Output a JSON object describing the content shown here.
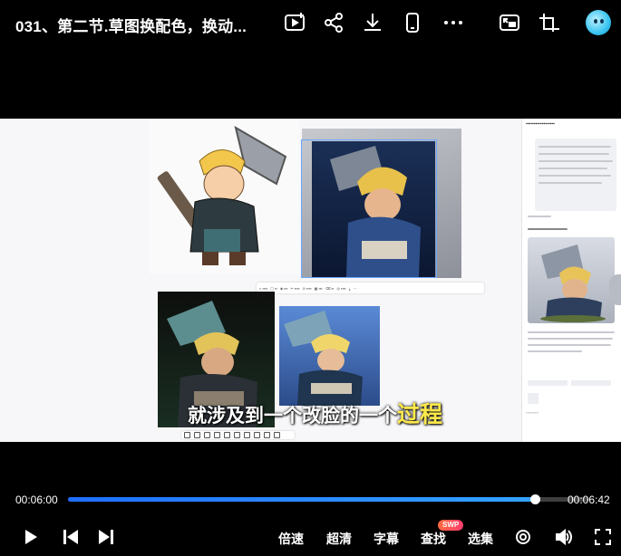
{
  "header": {
    "title": "031、第二节.草图换配色，换动...",
    "icons": [
      "video-add-icon",
      "share-icon",
      "download-icon",
      "phone-icon",
      "more-icon",
      "picture-in-picture-icon",
      "fullscreen-window-icon",
      "avatar"
    ]
  },
  "video": {
    "subtitle_prefix": "就涉及到一个改脸的一个",
    "subtitle_highlight": "过程",
    "subtitle_highlight_color": "#ffe94a"
  },
  "player": {
    "current_time": "00:06:00",
    "total_time": "00:06:42",
    "progress_fraction": 0.895,
    "accent": "#2a86ff",
    "speed_label": "倍速",
    "quality_label": "超清",
    "subtitles_label": "字幕",
    "search_label": "查找",
    "search_badge": "SWP",
    "episodes_label": "选集"
  }
}
